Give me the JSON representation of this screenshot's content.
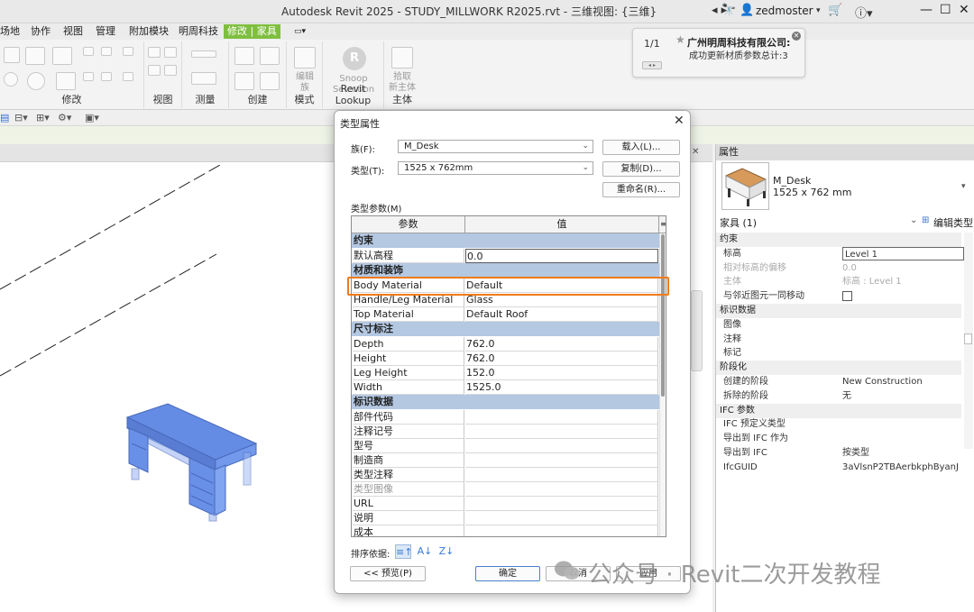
{
  "titlebar": {
    "title": "Autodesk Revit 2025 - STUDY_MILLWORK R2025.rvt - 三维视图: {三维}",
    "user": "zedmoster"
  },
  "ribbon_tabs": [
    "场地",
    "协作",
    "视图",
    "管理",
    "附加模块",
    "明周科技",
    "修改 | 家具"
  ],
  "ribbon_groups": [
    "修改",
    "视图",
    "测量",
    "创建",
    "模式",
    "Revit Lookup",
    "主体"
  ],
  "ribbon_buttons": {
    "edit_family": "编辑\n族",
    "snoop": "Snoop\nSelection",
    "pick_host": "拾取\n新主体"
  },
  "notification": {
    "counter": "1/1",
    "title": "广州明周科技有限公司:",
    "message": "成功更新材质参数总计:3"
  },
  "dialog": {
    "title": "类型属性",
    "family_label": "族(F):",
    "family_value": "M_Desk",
    "type_label": "类型(T):",
    "type_value": "1525 x 762mm",
    "load_button": "载入(L)...",
    "duplicate_button": "复制(D)...",
    "rename_button": "重命名(R)...",
    "type_params_label": "类型参数(M)",
    "col_param": "参数",
    "col_value": "值",
    "sort_label": "排序依据:",
    "preview_button": "<< 预览(P)",
    "ok_button": "确定",
    "cancel_button": "取消",
    "apply_button": "应用",
    "rows": [
      {
        "group": true,
        "param": "约束",
        "value": ""
      },
      {
        "param": "默认高程",
        "value": "0.0"
      },
      {
        "group": true,
        "param": "材质和装饰",
        "value": ""
      },
      {
        "param": "Body Material",
        "value": "Default"
      },
      {
        "param": "Handle/Leg Material",
        "value": "Glass"
      },
      {
        "param": "Top Material",
        "value": "Default Roof"
      },
      {
        "group": true,
        "param": "尺寸标注",
        "value": ""
      },
      {
        "param": "Depth",
        "value": "762.0"
      },
      {
        "param": "Height",
        "value": "762.0"
      },
      {
        "param": "Leg Height",
        "value": "152.0"
      },
      {
        "param": "Width",
        "value": "1525.0"
      },
      {
        "group": true,
        "param": "标识数据",
        "value": ""
      },
      {
        "param": "部件代码",
        "value": ""
      },
      {
        "param": "注释记号",
        "value": ""
      },
      {
        "param": "型号",
        "value": ""
      },
      {
        "param": "制造商",
        "value": ""
      },
      {
        "param": "类型注释",
        "value": ""
      },
      {
        "param": "类型图像",
        "value": "",
        "dim": true
      },
      {
        "param": "URL",
        "value": ""
      },
      {
        "param": "说明",
        "value": ""
      },
      {
        "param": "成本",
        "value": ""
      }
    ]
  },
  "properties": {
    "header": "属性",
    "type_name": "M_Desk",
    "type_size": "1525 x 762 mm",
    "category": "家具 (1)",
    "edit_type": "编辑类型",
    "rows": [
      {
        "group": true,
        "label": "约束",
        "value": ""
      },
      {
        "label": "标高",
        "value": "Level 1",
        "editable": true
      },
      {
        "label": "相对标高的偏移",
        "value": "0.0",
        "dim": true
      },
      {
        "label": "主体",
        "value": "标高 : Level 1",
        "dim": true
      },
      {
        "label": "与邻近图元一同移动",
        "value": "",
        "checkbox": true
      },
      {
        "group": true,
        "label": "标识数据",
        "value": ""
      },
      {
        "label": "图像",
        "value": ""
      },
      {
        "label": "注释",
        "value": ""
      },
      {
        "label": "标记",
        "value": ""
      },
      {
        "group": true,
        "label": "阶段化",
        "value": ""
      },
      {
        "label": "创建的阶段",
        "value": "New Construction"
      },
      {
        "label": "拆除的阶段",
        "value": "无"
      },
      {
        "group": true,
        "label": "IFC 参数",
        "value": ""
      },
      {
        "label": "IFC 预定义类型",
        "value": ""
      },
      {
        "label": "导出到 IFC 作为",
        "value": ""
      },
      {
        "label": "导出到 IFC",
        "value": "按类型"
      },
      {
        "label": "IfcGUID",
        "value": "3aVlsnP2TBAerbkphByanJ"
      }
    ]
  },
  "watermark": "公众号 · Revit二次开发教程",
  "colors": {
    "accent_orange": "#f07b1a",
    "group_blue": "#b4c8e2",
    "active_tab_green": "#7fbf3f",
    "desk_blue": "#4a78e0"
  }
}
